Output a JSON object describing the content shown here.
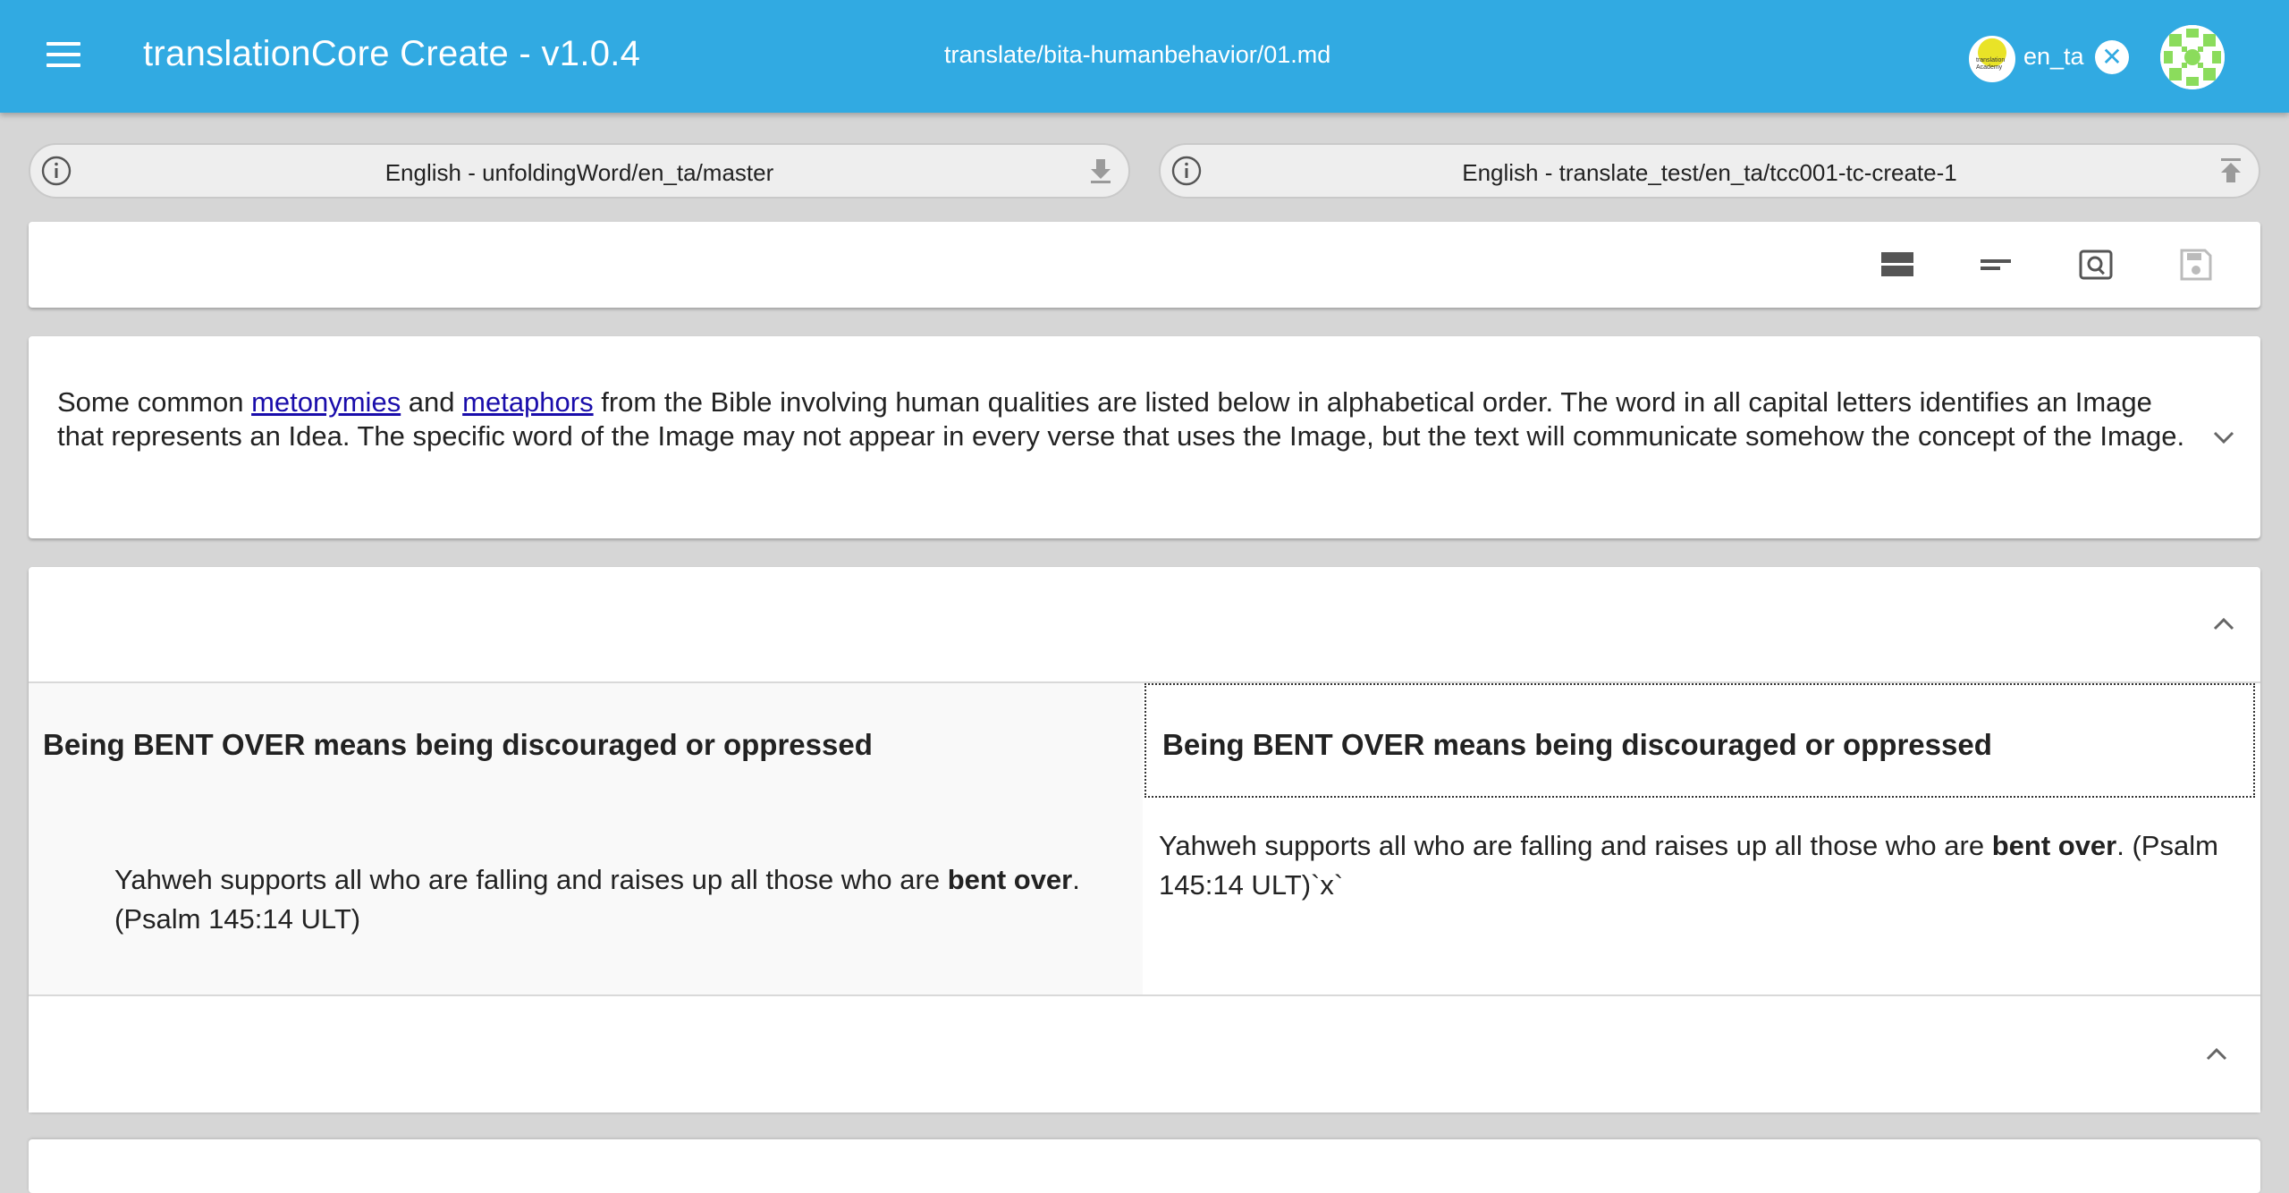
{
  "appbar": {
    "title": "translationCore Create - v1.0.4",
    "file_path": "translate/bita-humanbehavior/01.md",
    "language_code": "en_ta",
    "logo_text": "translation Academy",
    "close_symbol": "✕"
  },
  "resources": {
    "source_label": "English - unfoldingWord/en_ta/master",
    "target_label": "English - translate_test/en_ta/tcc001-tc-create-1"
  },
  "toolbar": {
    "buttons": [
      "view-rows-icon",
      "minus-lines-icon",
      "preview-icon",
      "save-icon"
    ]
  },
  "intro": {
    "text_before": "Some common ",
    "link1": "metonymies",
    "text_between": " and ",
    "link2": "metaphors",
    "text_after": " from the Bible involving human qualities are listed below in alphabetical order. The word in all capital letters identifies an Image that represents an Idea. The specific word of the Image may not appear in every verse that uses the Image, but the text will communicate somehow the concept of the Image."
  },
  "section": {
    "source_heading": "Being BENT OVER means being discouraged or oppressed",
    "target_heading": "Being BENT OVER means being discouraged or oppressed",
    "source_quote_before": "Yahweh supports all who are falling and raises up all those who are ",
    "source_quote_bold": "bent over",
    "source_quote_after": ". (Psalm 145:14 ULT)",
    "target_quote_before": "Yahweh supports all who are falling and raises up all those who are ",
    "target_quote_bold": "bent over",
    "target_quote_after": ". (Psalm 145:14 ULT)`x`"
  },
  "colors": {
    "appbar": "#31aae2",
    "link": "#1a0dab",
    "background": "#d6d6d6"
  }
}
